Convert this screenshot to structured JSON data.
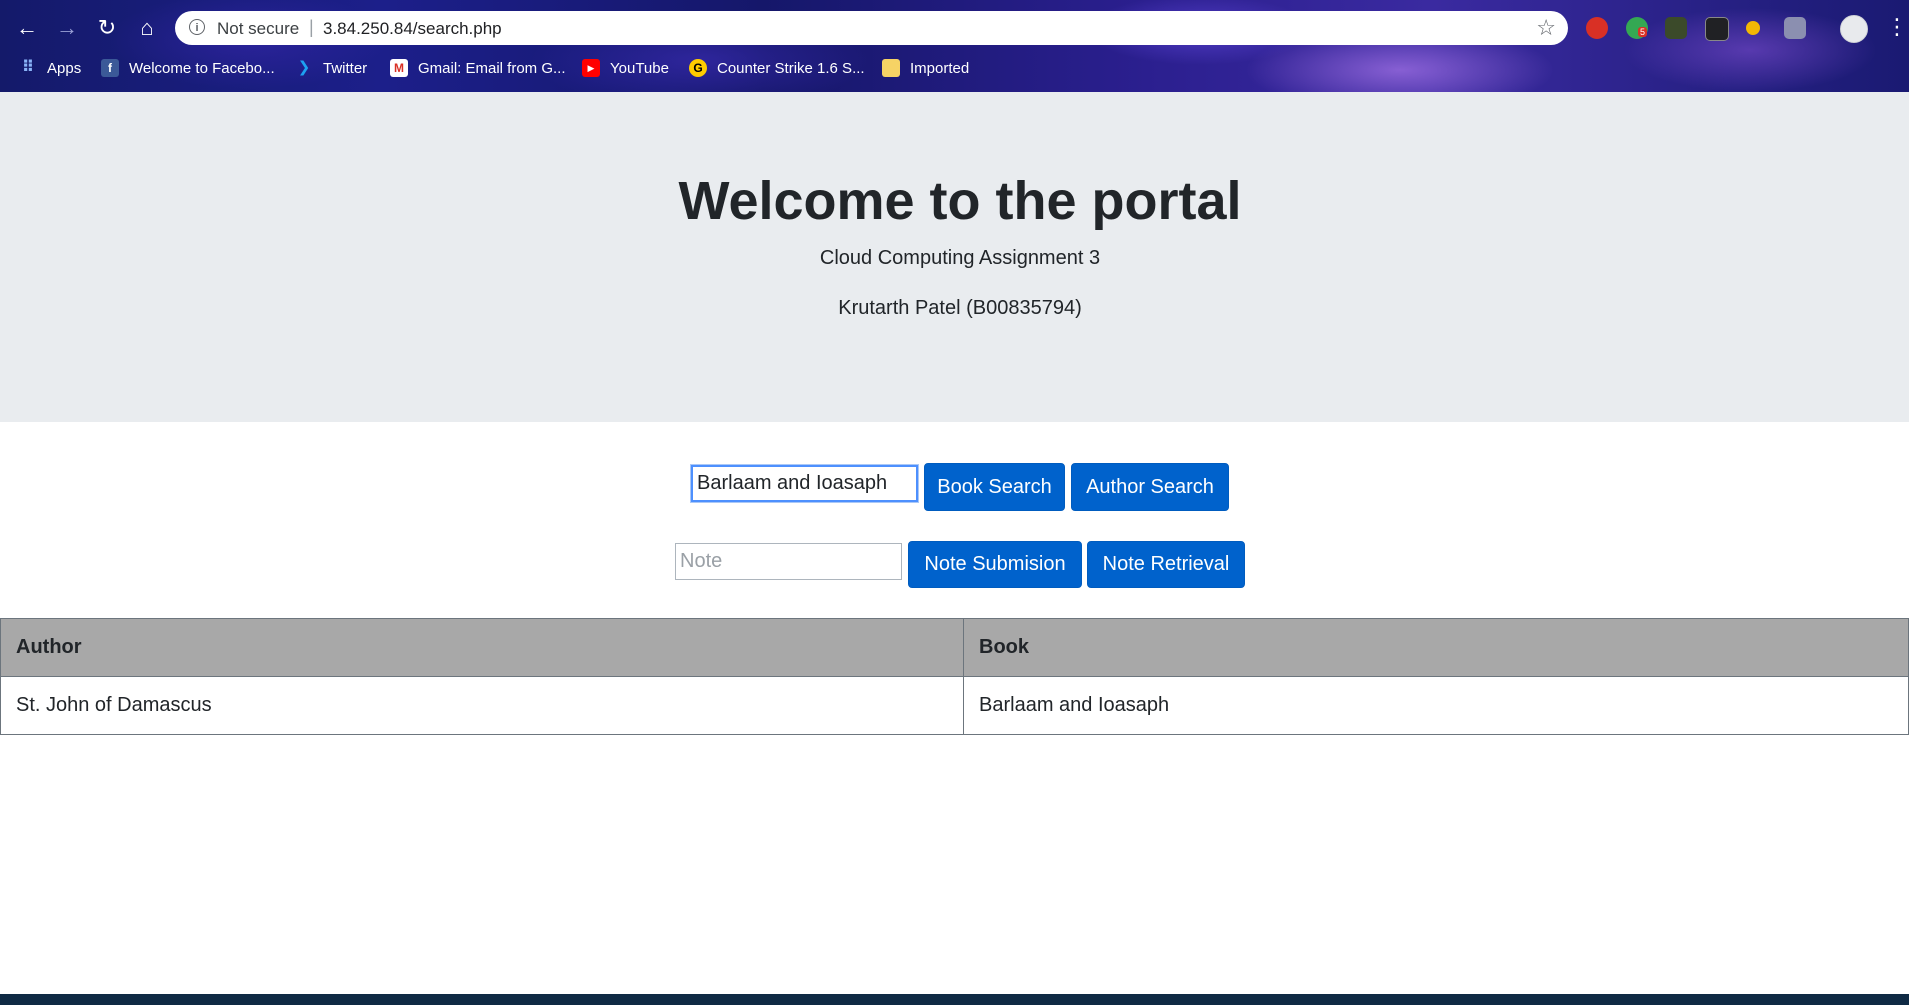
{
  "browser": {
    "security_label": "Not secure",
    "separator": "|",
    "url": "3.84.250.84/search.php",
    "bookmarks": [
      {
        "label": "Apps"
      },
      {
        "label": "Welcome to Facebo..."
      },
      {
        "label": "Twitter"
      },
      {
        "label": "Gmail: Email from G..."
      },
      {
        "label": "YouTube"
      },
      {
        "label": "Counter Strike 1.6 S..."
      },
      {
        "label": "Imported"
      }
    ],
    "extension_badge": "5",
    "icons": [
      "back-arrow-icon",
      "forward-arrow-icon",
      "reload-icon",
      "home-icon",
      "info-icon",
      "star-icon",
      "profile-avatar-icon",
      "menu-dots-icon"
    ]
  },
  "page": {
    "title": "Welcome to the portal",
    "subtitle": "Cloud Computing Assignment 3",
    "author_line": "Krutarth Patel (B00835794)",
    "search": {
      "value": "Barlaam and Ioasaph",
      "book_button": "Book Search",
      "author_button": "Author Search"
    },
    "note": {
      "placeholder": "Note",
      "submit_button": "Note Submision",
      "retrieve_button": "Note Retrieval"
    },
    "table": {
      "headers": [
        "Author",
        "Book"
      ],
      "rows": [
        [
          "St. John of Damascus",
          "Barlaam and Ioasaph"
        ]
      ]
    }
  },
  "colors": {
    "primary_button": "#0062cc",
    "jumbotron_bg": "#e9ecef",
    "table_header_bg": "#a8a8a8"
  }
}
